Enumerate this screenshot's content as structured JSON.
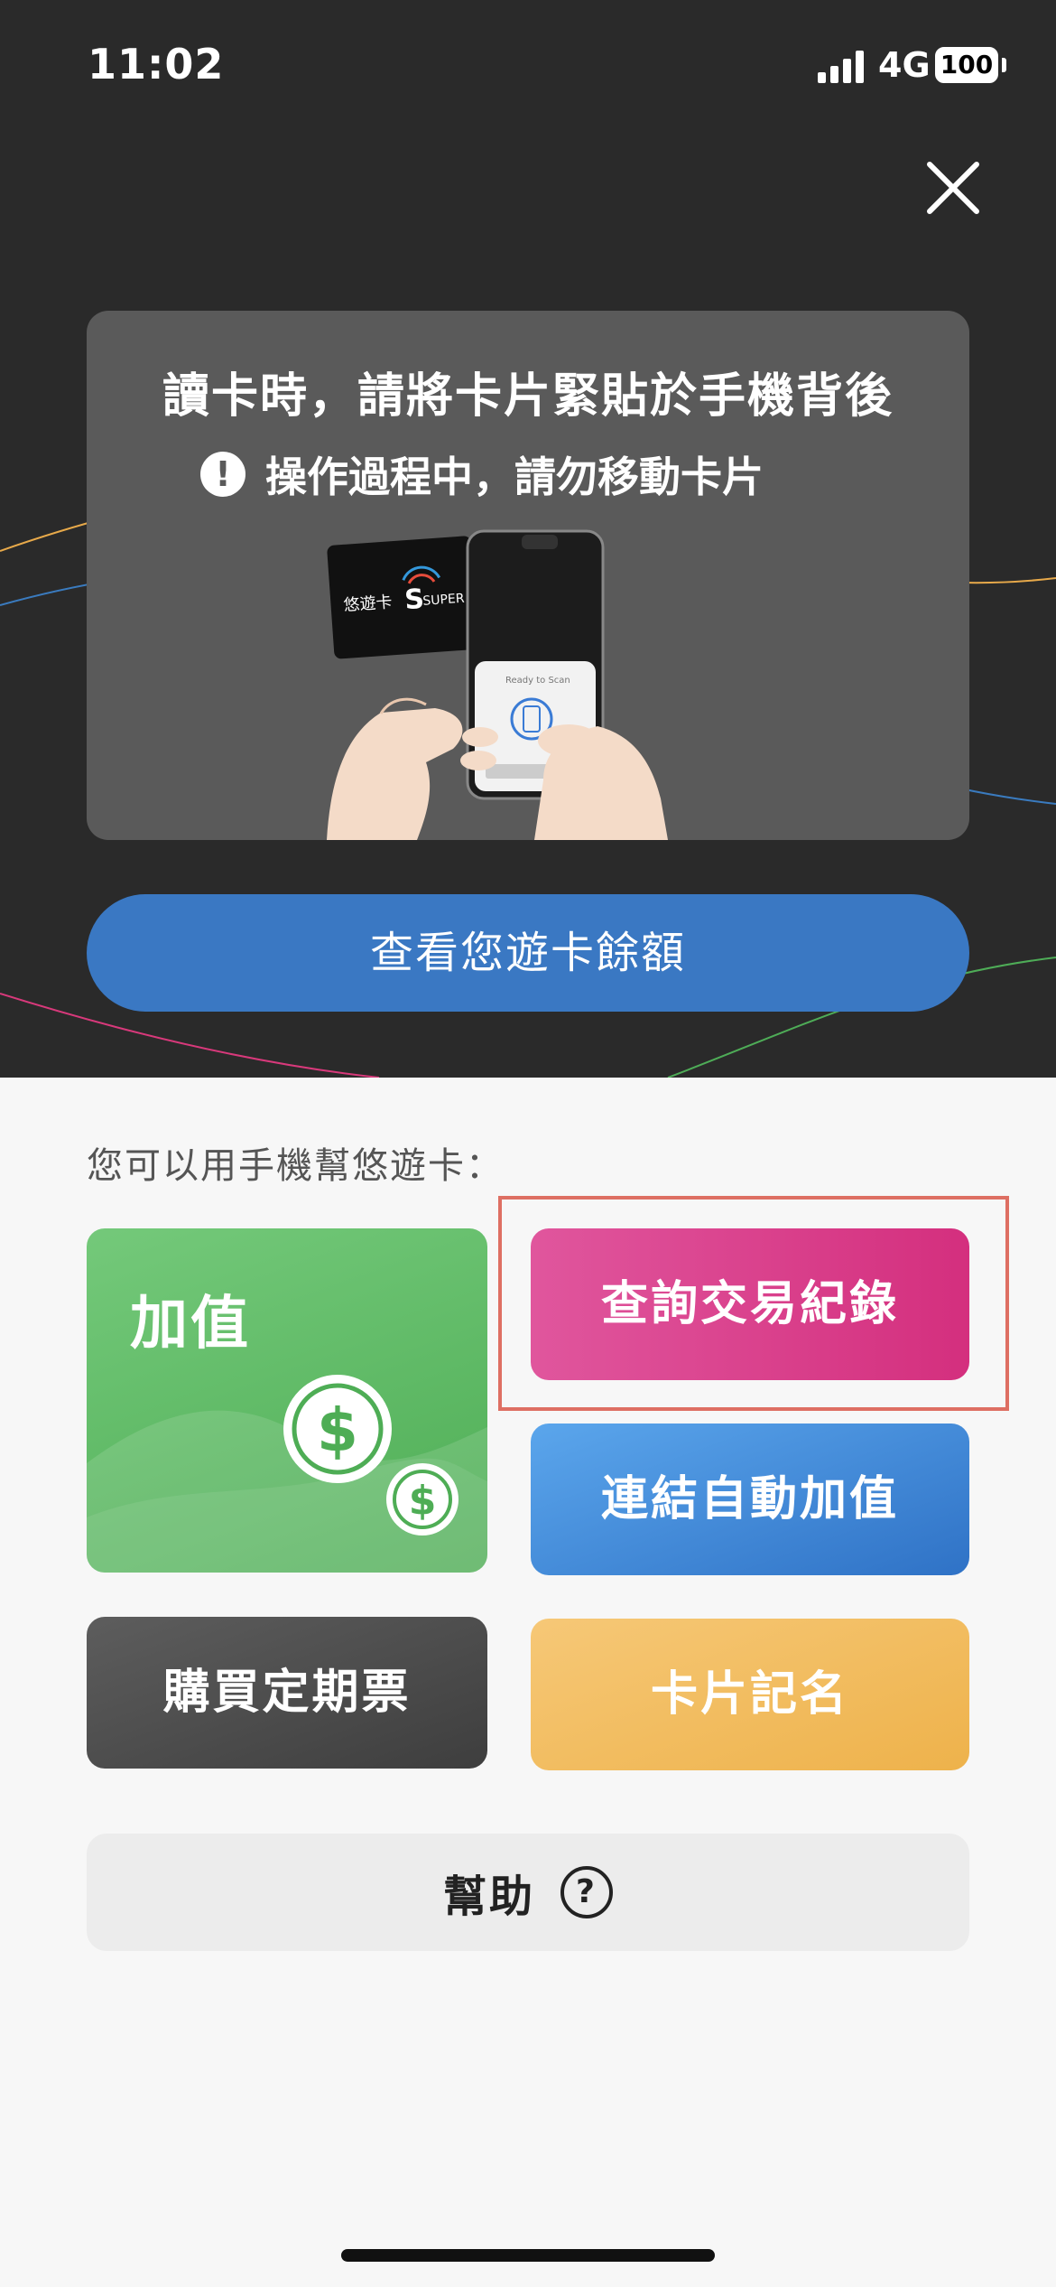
{
  "status_bar": {
    "time": "11:02",
    "network": "4G",
    "battery": "100"
  },
  "instructions": {
    "title": "讀卡時，請將卡片緊貼於手機背後",
    "warning": "操作過程中，請勿移動卡片",
    "card_logo_text": "悠遊卡",
    "card_logo_brand": "SUPER",
    "phone_screen_text": "Ready to Scan"
  },
  "balance_button": "查看您遊卡餘額",
  "section_label": "您可以用手機幫悠遊卡：",
  "tiles": {
    "top_up": "加值",
    "query_records": "查詢交易紀錄",
    "link_auto_reload": "連結自動加值",
    "buy_pass": "購買定期票",
    "register_card": "卡片記名"
  },
  "help": {
    "label": "幫助",
    "icon": "?"
  },
  "colors": {
    "dark_bg": "#2a2a2a",
    "balance_blue": "#3a78c3",
    "green": "#5cb863",
    "pink": "#d93d86",
    "blue": "#3f87d8",
    "dark_tile": "#4b4b4b",
    "yellow": "#f1bb5e",
    "highlight_border": "#de6f63"
  }
}
